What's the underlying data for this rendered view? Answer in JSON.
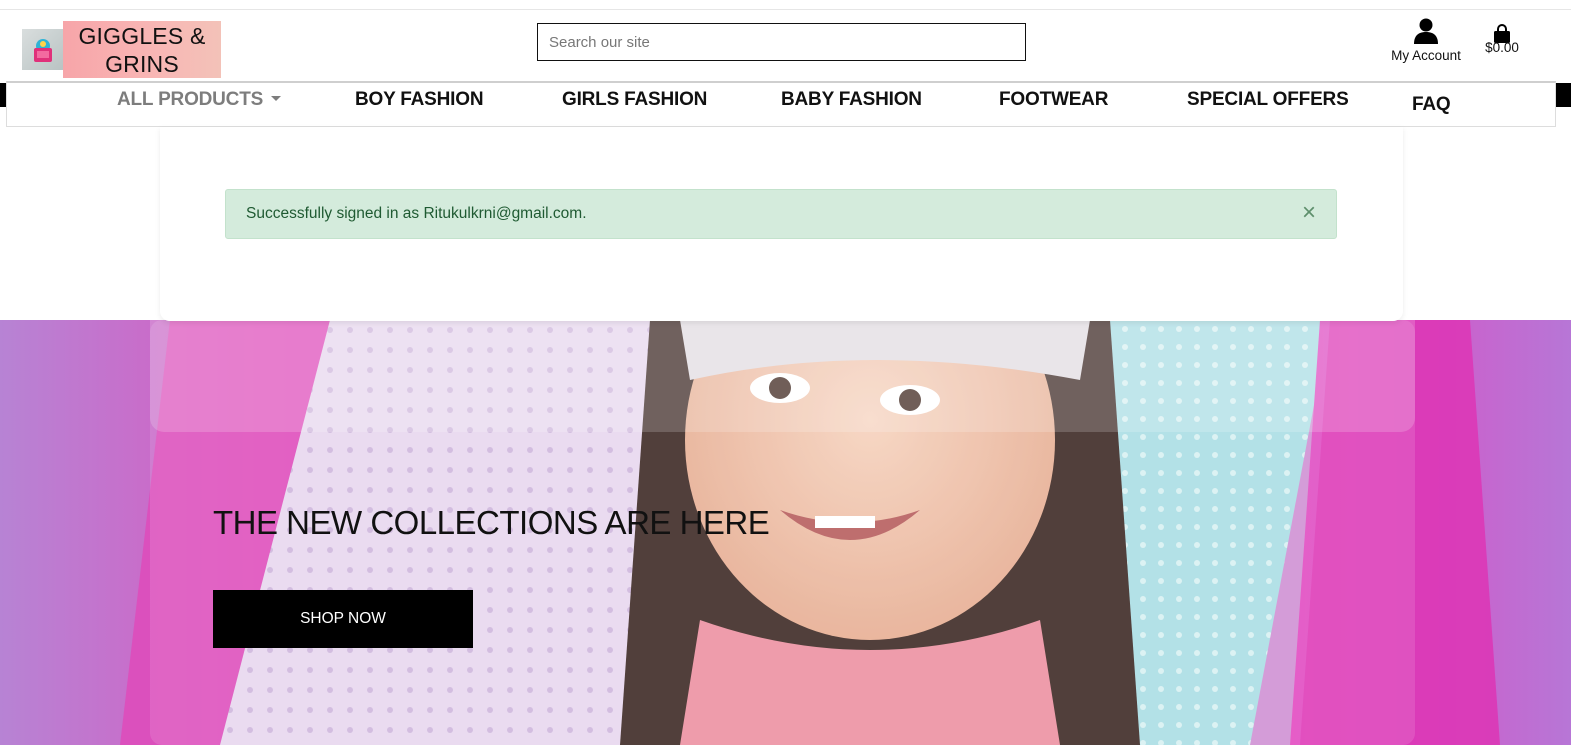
{
  "header": {
    "logo_line1": "GIGGLES &",
    "logo_line2": "GRINS",
    "search_placeholder": "Search our site",
    "account_label": "My Account",
    "cart_total": "$0.00"
  },
  "nav": {
    "items": [
      {
        "label": "ALL PRODUCTS",
        "has_dropdown": true
      },
      {
        "label": "BOY FASHION"
      },
      {
        "label": "GIRLS FASHION"
      },
      {
        "label": "BABY FASHION"
      },
      {
        "label": "FOOTWEAR"
      },
      {
        "label": "SPECIAL OFFERS"
      },
      {
        "label": "FAQ"
      }
    ]
  },
  "alert": {
    "message": "Successfully signed in as Ritukulkrni@gmail.com.",
    "close_symbol": "×",
    "color": "#d4ebdc"
  },
  "hero": {
    "title": "THE NEW COLLECTIONS ARE HERE",
    "cta_label": "SHOP NOW"
  },
  "icons": {
    "account": "user-icon",
    "cart": "shopping-bag-icon",
    "logo": "shopping-bag-logo-icon",
    "dropdown": "caret-down-icon",
    "close": "close-icon"
  },
  "colors": {
    "logo_bg": "#f7a5a9",
    "hero_pink": "#d23fb6",
    "hero_teal": "#a9dfe3",
    "button_bg": "#000000"
  }
}
